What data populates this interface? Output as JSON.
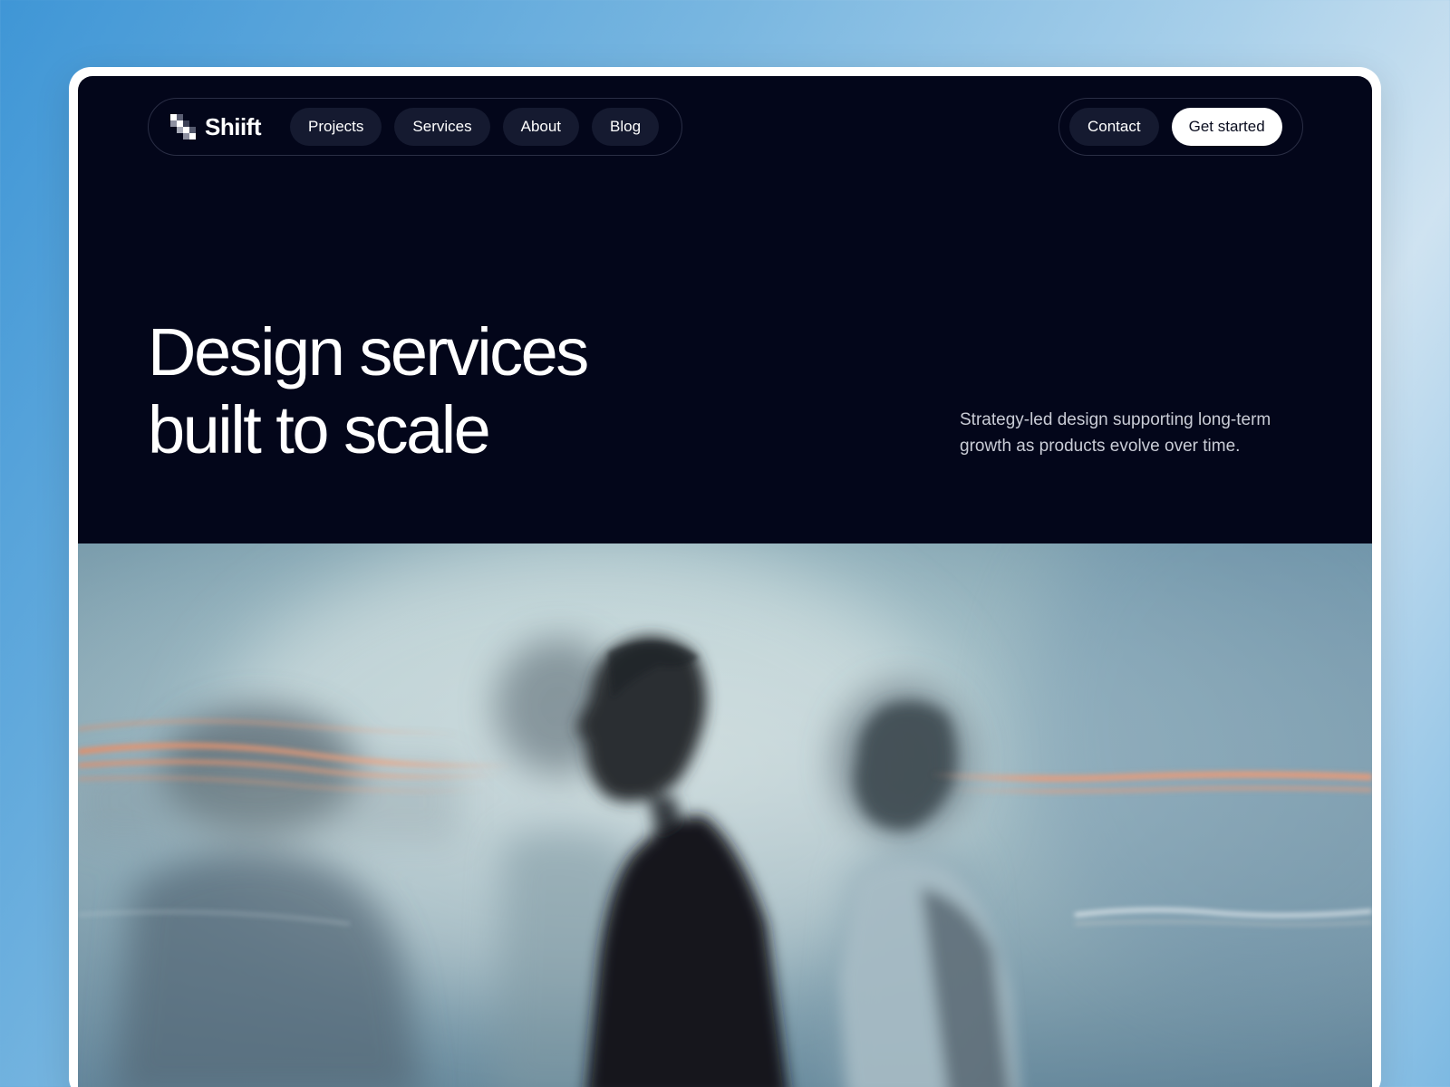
{
  "brand": {
    "name": "Shiift"
  },
  "nav": {
    "items": [
      {
        "label": "Projects"
      },
      {
        "label": "Services"
      },
      {
        "label": "About"
      },
      {
        "label": "Blog"
      }
    ],
    "contact_label": "Contact",
    "cta_label": "Get started"
  },
  "hero": {
    "title_line1": "Design services",
    "title_line2": "built to scale",
    "subtitle_line1": "Strategy-led design supporting long-term",
    "subtitle_line2": "growth as products evolve over time."
  },
  "colors": {
    "page_background": "#4a9ad6",
    "hero_background": "#03061a",
    "pill_background": "#151a30",
    "cta_background": "#ffffff",
    "light_streak": "#f08a5d"
  }
}
